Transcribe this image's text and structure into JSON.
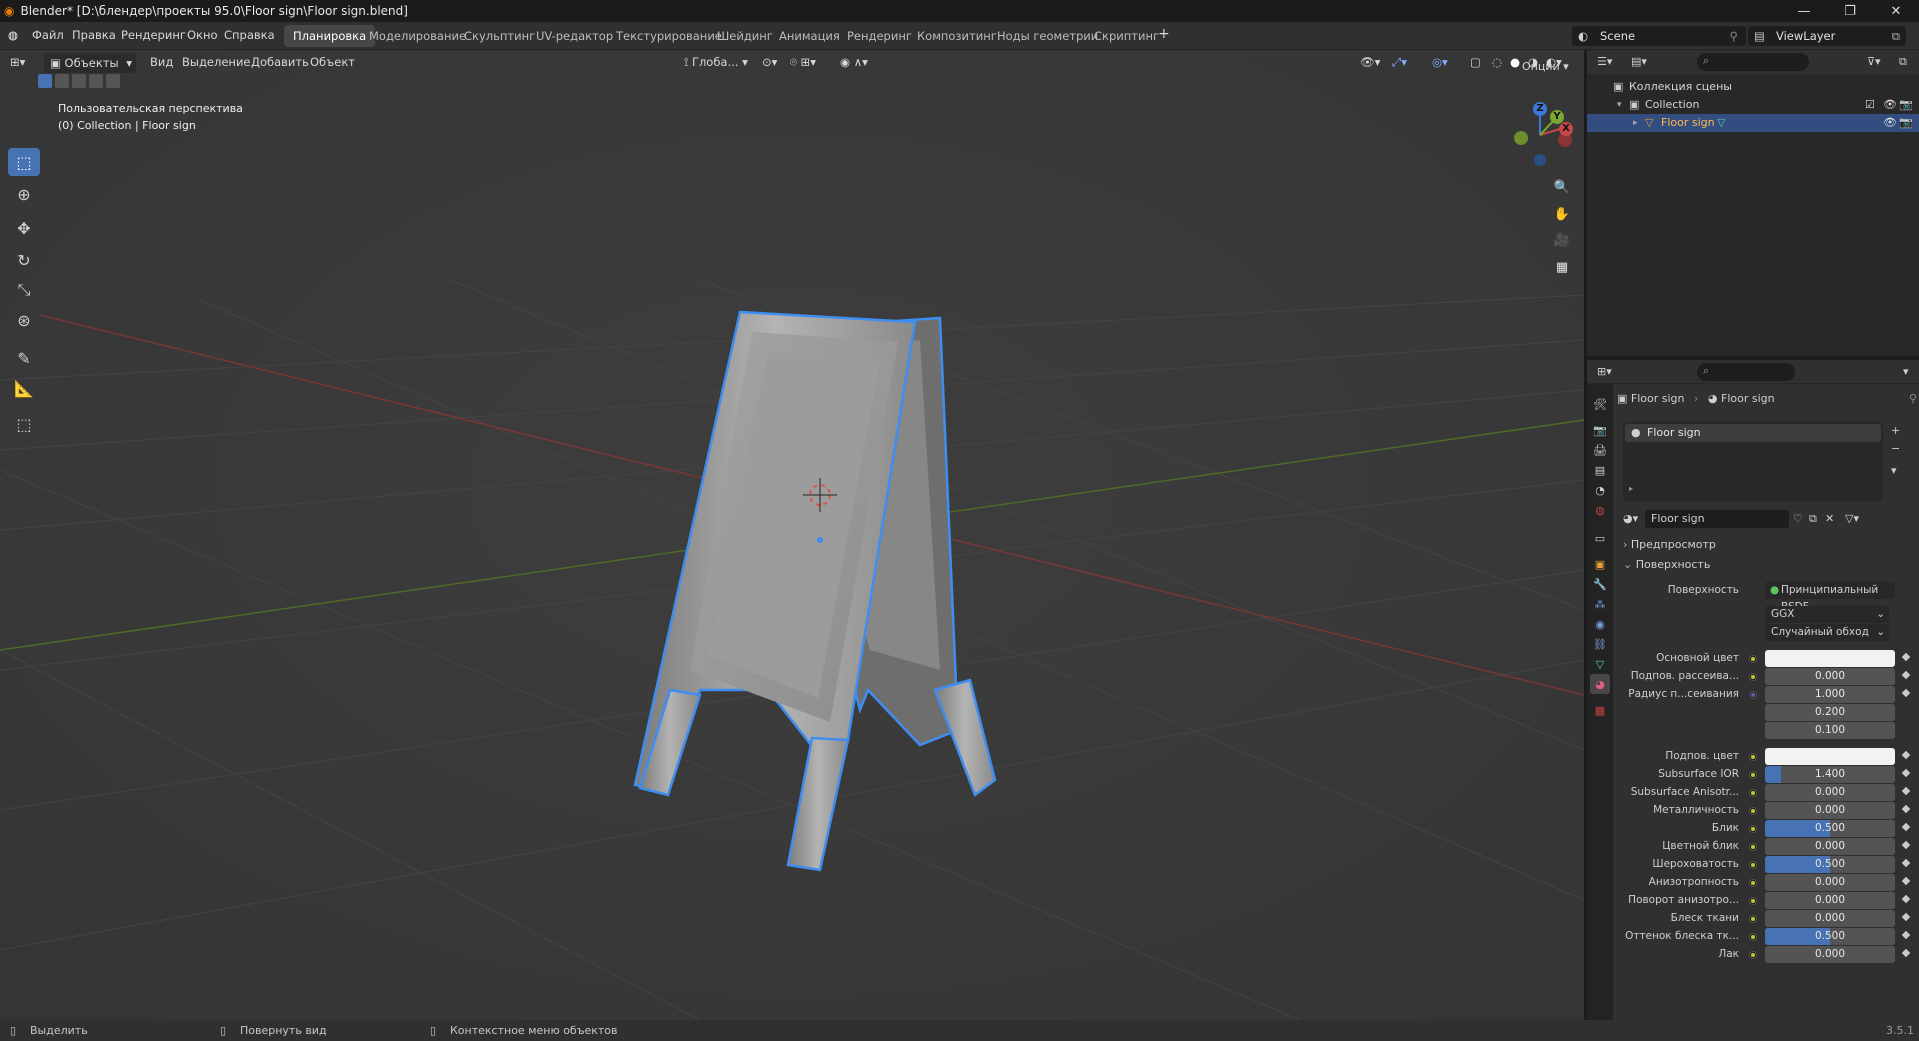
{
  "window": {
    "title": "Blender* [D:\\блендер\\проекты 95.0\\Floor sign\\Floor sign.blend]",
    "controls": [
      "—",
      "❐",
      "✕"
    ]
  },
  "menu": [
    "Файл",
    "Правка",
    "Рендеринг",
    "Окно",
    "Справка"
  ],
  "workspaces": [
    "Планировка",
    "Моделирование",
    "Скульптинг",
    "UV-редактор",
    "Текстурирование",
    "Шейдинг",
    "Анимация",
    "Рендеринг",
    "Композитинг",
    "Ноды геометрии",
    "Скриптинг"
  ],
  "scene_field": "Scene",
  "viewlayer_field": "ViewLayer",
  "viewport_header": {
    "mode": "Объекты",
    "menus": [
      "Вид",
      "Выделение",
      "Добавить",
      "Объект"
    ],
    "orientation": "Глоба...",
    "options": "Опции"
  },
  "viewport_info": {
    "line1": "Пользовательская перспектива",
    "line2": "(0) Collection | Floor sign"
  },
  "gizmo": {
    "x": "X",
    "y": "Y",
    "z": "Z"
  },
  "outliner": {
    "root": "Коллекция сцены",
    "collection": "Collection",
    "object": "Floor sign"
  },
  "properties": {
    "breadcrumb_object": "Floor sign",
    "breadcrumb_material": "Floor sign",
    "slot_name": "Floor sign",
    "material_name": "Floor sign",
    "section_preview": "Предпросмотр",
    "section_surface": "Поверхность",
    "surface_label": "Поверхность",
    "surface_value": "Принципиальный BSDF",
    "distribution": "GGX",
    "subsurface_method": "Случайный обход",
    "rows": [
      {
        "label": "Основной цвет",
        "value": "",
        "color": "#f2f2f2",
        "dot": "yellow"
      },
      {
        "label": "Подпов. рассеива...",
        "value": "0.000",
        "fill": 0,
        "dot": "yellow"
      },
      {
        "label": "Радиус п...сеивания",
        "value": "1.000",
        "fill": 0,
        "dot": "blue"
      },
      {
        "label": "",
        "value": "0.200",
        "fill": 0,
        "dot": ""
      },
      {
        "label": "",
        "value": "0.100",
        "fill": 0,
        "dot": ""
      },
      {
        "label": "Подпов. цвет",
        "value": "",
        "color": "#f2f2f2",
        "dot": "yellow"
      },
      {
        "label": "Subsurface IOR",
        "value": "1.400",
        "fill": 0.12,
        "dot": "yellow"
      },
      {
        "label": "Subsurface Anisotr...",
        "value": "0.000",
        "fill": 0,
        "dot": "yellow"
      },
      {
        "label": "Металличность",
        "value": "0.000",
        "fill": 0,
        "dot": "yellow"
      },
      {
        "label": "Блик",
        "value": "0.500",
        "fill": 0.5,
        "dot": "yellow"
      },
      {
        "label": "Цветной блик",
        "value": "0.000",
        "fill": 0,
        "dot": "yellow"
      },
      {
        "label": "Шероховатость",
        "value": "0.500",
        "fill": 0.5,
        "dot": "yellow"
      },
      {
        "label": "Анизотропность",
        "value": "0.000",
        "fill": 0,
        "dot": "yellow"
      },
      {
        "label": "Поворот анизотро...",
        "value": "0.000",
        "fill": 0,
        "dot": "yellow"
      },
      {
        "label": "Блеск ткани",
        "value": "0.000",
        "fill": 0,
        "dot": "yellow"
      },
      {
        "label": "Оттенок блеска тк...",
        "value": "0.500",
        "fill": 0.5,
        "dot": "yellow"
      },
      {
        "label": "Лак",
        "value": "0.000",
        "fill": 0,
        "dot": "yellow"
      }
    ]
  },
  "status": {
    "select": "Выделить",
    "rotate": "Повернуть вид",
    "context": "Контекстное меню объектов",
    "version": "3.5.1"
  },
  "colors": {
    "accent": "#4772b3",
    "selection_outline": "#3d8ef0",
    "axis_x": "#b54141",
    "axis_y": "#6e8e2a",
    "object_orange": "#e8a13a"
  }
}
